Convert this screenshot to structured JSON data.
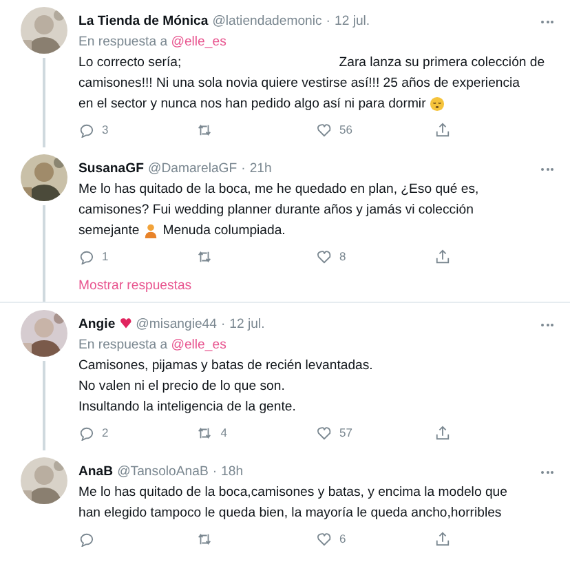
{
  "items": [
    {
      "kind": "tweet",
      "name": "La Tienda de Mónica",
      "heart_badge": false,
      "handle": "@latiendademonic",
      "separator": "·",
      "time": "12 jul.",
      "reply_prefix": "En respuesta a",
      "reply_to": "@elle_es",
      "thread_below": true,
      "lines": [
        [
          {
            "kind": "text",
            "text": "Lo correcto sería;                                           Zara lanza su primera colección de"
          }
        ],
        [
          {
            "kind": "text",
            "text": "camisones!!! Ni una sola novia quiere vestirse así!!! 25 años de experiencia"
          }
        ],
        [
          {
            "kind": "text",
            "text": "en el sector y nunca nos han pedido algo así ni para dormir"
          },
          {
            "kind": "sleepy_emoji"
          }
        ]
      ],
      "replies": "3",
      "likes": "56"
    },
    {
      "kind": "tweet",
      "name": "SusanaGF",
      "heart_badge": false,
      "handle": "@DamarelaGF",
      "separator": "·",
      "time": "21h",
      "thread_below": true,
      "lines": [
        [
          {
            "kind": "text",
            "text": "Me lo has quitado de la boca, me he quedado en plan, ¿Eso qué es,"
          }
        ],
        [
          {
            "kind": "text",
            "text": "camisones? Fui wedding planner durante años y jamás vi colección"
          }
        ],
        [
          {
            "kind": "text",
            "text": "semejante"
          },
          {
            "kind": "person_emoji"
          },
          {
            "kind": "text",
            "text": "Menuda columpiada."
          }
        ]
      ],
      "replies": "1",
      "likes": "8"
    },
    {
      "kind": "show_replies",
      "label": "Mostrar respuestas"
    },
    {
      "kind": "tweet",
      "name": "Angie",
      "heart_badge": true,
      "handle": "@misangie44",
      "separator": "·",
      "time": "12 jul.",
      "reply_prefix": "En respuesta a",
      "reply_to": "@elle_es",
      "thread_below": true,
      "lines": [
        [
          {
            "kind": "text",
            "text": "Camisones, pijamas y batas de recién levantadas."
          }
        ],
        [
          {
            "kind": "text",
            "text": "No valen ni el precio de lo que son."
          }
        ],
        [
          {
            "kind": "text",
            "text": "Insultando la inteligencia de la gente."
          }
        ]
      ],
      "replies": "2",
      "retweets": "4",
      "likes": "57"
    },
    {
      "kind": "tweet",
      "name": "AnaB",
      "heart_badge": false,
      "handle": "@TansoloAnaB",
      "separator": "·",
      "time": "18h",
      "thread_below": false,
      "lines": [
        [
          {
            "kind": "text",
            "text": "Me lo has quitado de la boca,camisones y batas, y encima la modelo que"
          }
        ],
        [
          {
            "kind": "text",
            "text": "han elegido tampoco le queda bien, la mayoría le queda ancho,horribles"
          }
        ]
      ],
      "likes": "6"
    }
  ]
}
